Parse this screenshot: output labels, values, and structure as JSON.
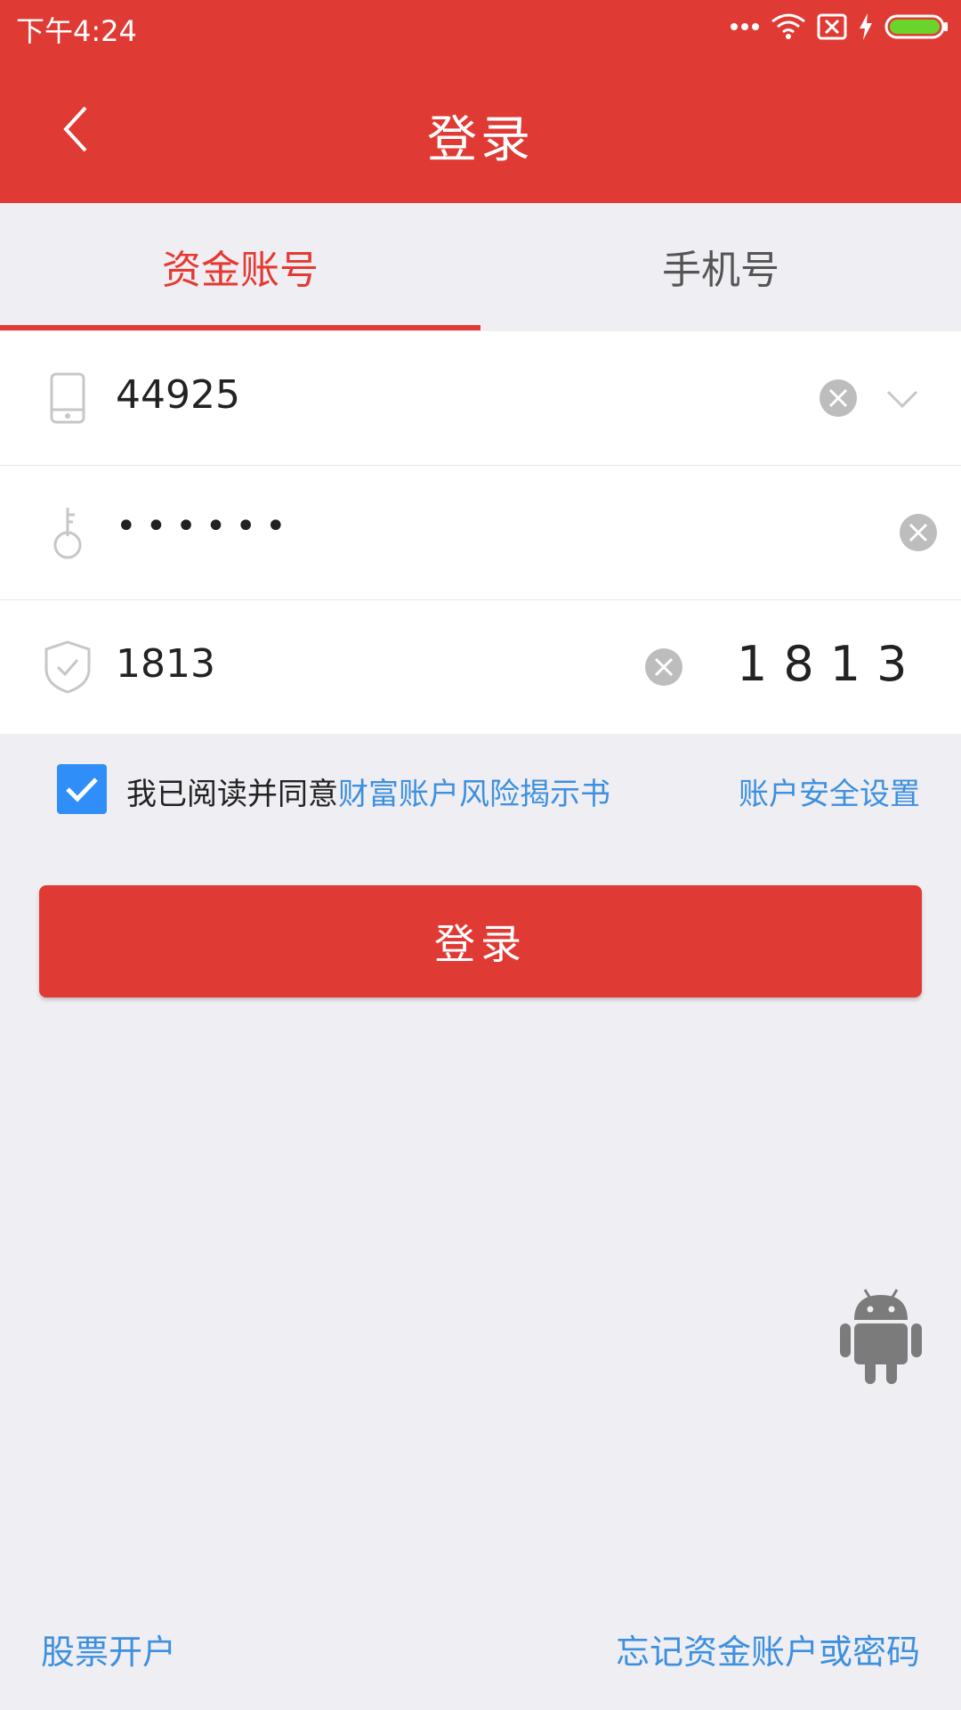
{
  "status_bar": {
    "time": "下午4:24",
    "icons": [
      "more-dots-icon",
      "wifi-icon",
      "no-sim-icon",
      "charging-icon",
      "battery-icon"
    ]
  },
  "header": {
    "title": "登录",
    "back_icon": "chevron-left-icon"
  },
  "tabs": [
    {
      "label": "资金账号",
      "active": true
    },
    {
      "label": "手机号",
      "active": false
    }
  ],
  "form": {
    "account": {
      "value": "44925",
      "icon": "phone-icon"
    },
    "password": {
      "value": "••••••",
      "icon": "key-icon"
    },
    "captcha": {
      "value": "1813",
      "code": "1813",
      "icon": "shield-check-icon"
    }
  },
  "agreement": {
    "checked": true,
    "prefix": "我已阅读并同意",
    "link": "财富账户风险揭示书",
    "security_link": "账户安全设置"
  },
  "login_button": "登录",
  "footer": {
    "open_account": "股票开户",
    "forgot": "忘记资金账户或密码"
  },
  "colors": {
    "primary": "#e03a34",
    "link": "#3d90df",
    "checkbox": "#2f8ef7",
    "background": "#efeef3"
  }
}
